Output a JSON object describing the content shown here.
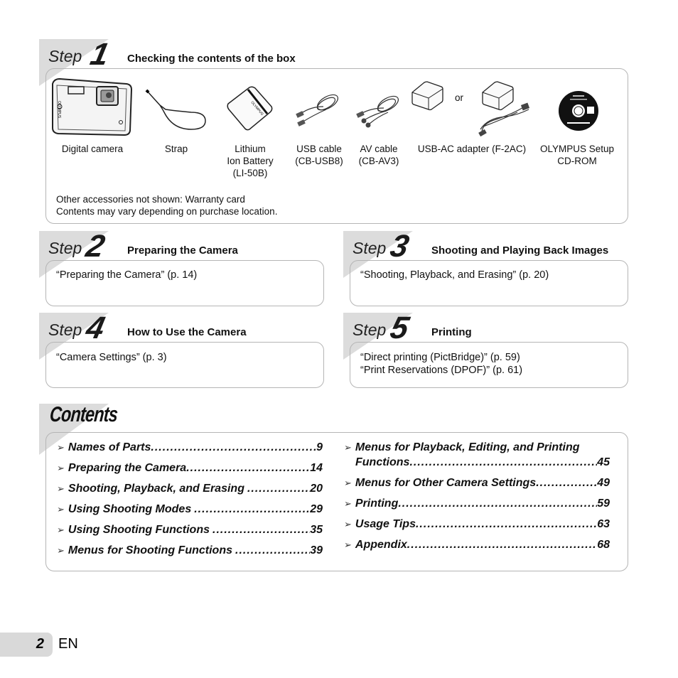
{
  "steps": [
    {
      "word": "Step",
      "number": "1",
      "title": "Checking the contents of the box"
    },
    {
      "word": "Step",
      "number": "2",
      "title": "Preparing the Camera",
      "refs": [
        "“Preparing the Camera” (p. 14)"
      ]
    },
    {
      "word": "Step",
      "number": "3",
      "title": "Shooting and Playing Back Images",
      "refs": [
        "“Shooting, Playback, and Erasing” (p. 20)"
      ]
    },
    {
      "word": "Step",
      "number": "4",
      "title": "How to Use the Camera",
      "refs": [
        "“Camera Settings” (p. 3)"
      ]
    },
    {
      "word": "Step",
      "number": "5",
      "title": "Printing",
      "refs": [
        "“Direct printing (PictBridge)” (p. 59)",
        "“Print Reservations (DPOF)” (p. 61)"
      ]
    }
  ],
  "box_contents": {
    "items": [
      {
        "icon": "digital-camera-icon",
        "lines": [
          "Digital camera"
        ]
      },
      {
        "icon": "strap-icon",
        "lines": [
          "Strap"
        ]
      },
      {
        "icon": "battery-icon",
        "lines": [
          "Lithium",
          "Ion Battery",
          "(LI-50B)"
        ]
      },
      {
        "icon": "usb-cable-icon",
        "lines": [
          "USB cable",
          "(CB-USB8)"
        ]
      },
      {
        "icon": "av-cable-icon",
        "lines": [
          "AV cable",
          "(CB-AV3)"
        ]
      },
      {
        "icon": "usb-ac-adapter-icon",
        "lines": [
          "USB-AC adapter (F-2AC)"
        ]
      },
      {
        "icon": "cd-rom-icon",
        "lines": [
          "OLYMPUS Setup",
          "CD-ROM"
        ]
      }
    ],
    "or_label": "or",
    "notes": [
      "Other accessories not shown: Warranty card",
      "Contents may vary depending on purchase location."
    ]
  },
  "contents": {
    "title": "Contents",
    "left": [
      {
        "label": "Names of Parts",
        "page": "9"
      },
      {
        "label": "Preparing the Camera",
        "page": "14"
      },
      {
        "label": "Shooting, Playback, and Erasing",
        "page": "20"
      },
      {
        "label": "Using Shooting Modes",
        "page": "29"
      },
      {
        "label": "Using Shooting Functions",
        "page": "35"
      },
      {
        "label": "Menus for Shooting Functions",
        "page": "39"
      }
    ],
    "right": [
      {
        "label_line1": "Menus for Playback, Editing, and Printing",
        "label": "Functions",
        "page": "45"
      },
      {
        "label": "Menus for Other Camera Settings",
        "page": "49"
      },
      {
        "label": "Printing",
        "page": "59"
      },
      {
        "label": "Usage Tips",
        "page": "63"
      },
      {
        "label": "Appendix",
        "page": "68"
      }
    ],
    "arrow_icon": "➢",
    "dots": "..............................................................................................."
  },
  "footer": {
    "page_number": "2",
    "language": "EN"
  }
}
